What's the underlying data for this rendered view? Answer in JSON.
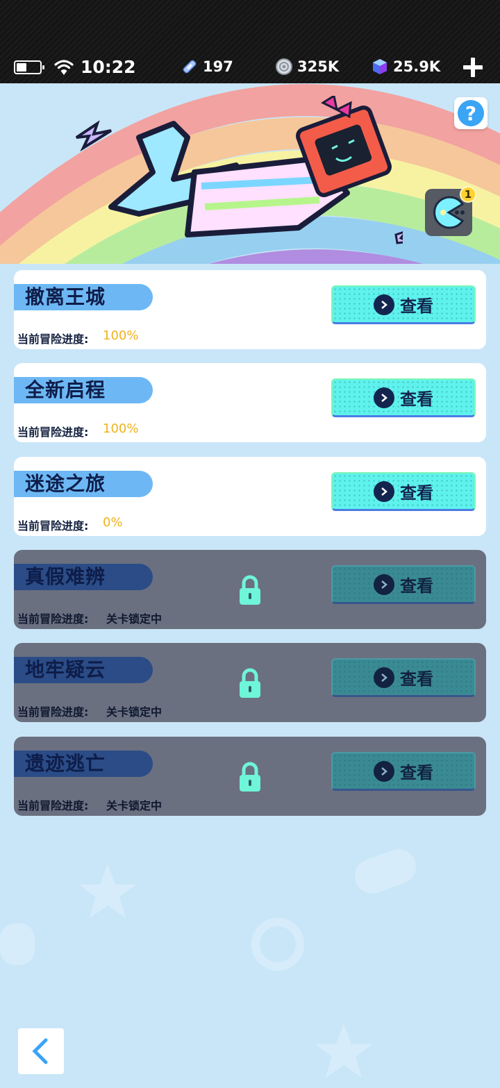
{
  "status_bar": {
    "time": "10:22",
    "stamina": "197",
    "coins": "325K",
    "gems": "25.9K",
    "icons": [
      "battery-icon",
      "wifi-icon",
      "stamina-icon",
      "coin-icon",
      "gem-icon",
      "plus-icon"
    ]
  },
  "header": {
    "help_label": "?",
    "notification_count": "1"
  },
  "colors": {
    "card_bg": "#ffffff",
    "locked_card_bg": "#6a7080",
    "name_pill": "#6db8f4",
    "button_cyan": "#5ff2ec",
    "progress_orange": "#f1b21c",
    "lock_green": "#6ff5d8"
  },
  "progress_label": "当前冒险进度:",
  "view_label": "查看",
  "chapters": [
    {
      "name": "撤离王城",
      "progress": "100%",
      "locked": false
    },
    {
      "name": "全新启程",
      "progress": "100%",
      "locked": false
    },
    {
      "name": "迷途之旅",
      "progress": "0%",
      "locked": false
    },
    {
      "name": "真假难辨",
      "progress": "关卡锁定中",
      "locked": true
    },
    {
      "name": "地牢疑云",
      "progress": "关卡锁定中",
      "locked": true
    },
    {
      "name": "遗迹逃亡",
      "progress": "关卡锁定中",
      "locked": true
    }
  ]
}
